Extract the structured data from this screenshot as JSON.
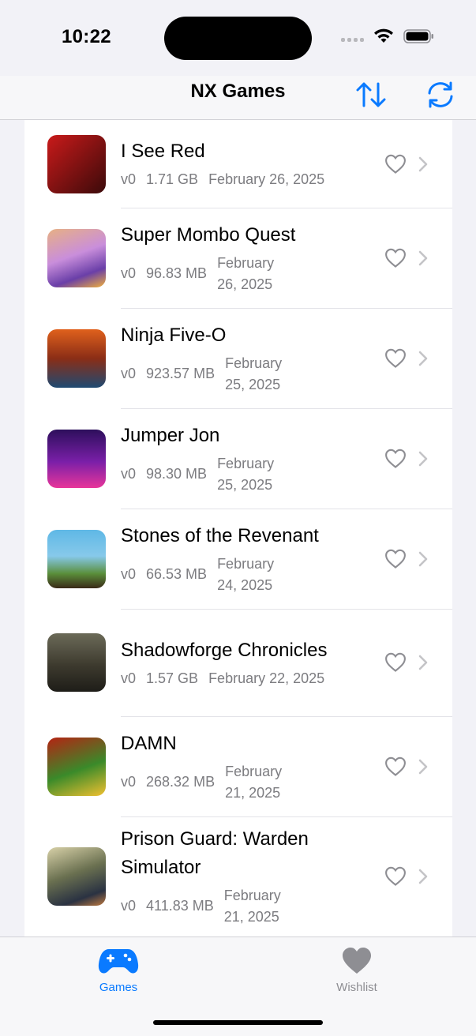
{
  "status_bar": {
    "time": "10:22"
  },
  "nav": {
    "title": "NX Games"
  },
  "colors": {
    "accent": "#0a7aff",
    "secondary_text": "#7c7c80",
    "icon_gray": "#8e8e93"
  },
  "games": [
    {
      "title": "I See Red",
      "version": "v0",
      "size": "1.71 GB",
      "date": "February 26, 2025"
    },
    {
      "title": "Super Mombo Quest",
      "version": "v0",
      "size": "96.83 MB",
      "date": "February 26, 2025"
    },
    {
      "title": "Ninja Five-O",
      "version": "v0",
      "size": "923.57 MB",
      "date": "February 25, 2025"
    },
    {
      "title": "Jumper Jon",
      "version": "v0",
      "size": "98.30 MB",
      "date": "February 25, 2025"
    },
    {
      "title": "Stones of the Revenant",
      "version": "v0",
      "size": "66.53 MB",
      "date": "February 24, 2025"
    },
    {
      "title": "Shadowforge Chronicles",
      "version": "v0",
      "size": "1.57 GB",
      "date": "February 22, 2025"
    },
    {
      "title": "DAMN",
      "version": "v0",
      "size": "268.32 MB",
      "date": "February 21, 2025"
    },
    {
      "title": "Prison Guard: Warden Simulator",
      "version": "v0",
      "size": "411.83 MB",
      "date": "February 21, 2025"
    }
  ],
  "tabs": [
    {
      "label": "Games",
      "icon": "gamecontroller-icon",
      "selected": true
    },
    {
      "label": "Wishlist",
      "icon": "heart-icon",
      "selected": false
    }
  ]
}
